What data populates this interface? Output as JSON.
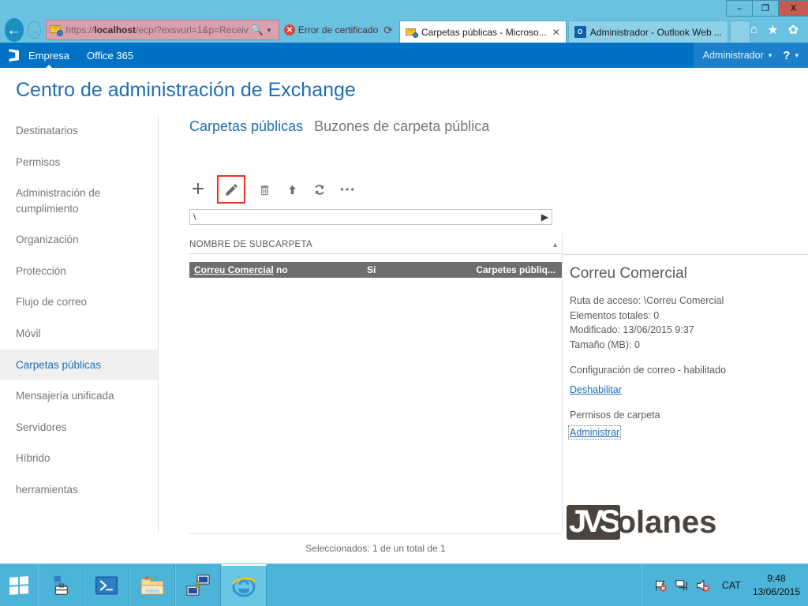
{
  "browser": {
    "window_buttons": {
      "minimize": "–",
      "maximize": "❐",
      "close": "X"
    },
    "back_label": "←",
    "forward_label": "→",
    "address": {
      "scheme": "https://",
      "host": "localhost",
      "path": "/ecp/?exsvurl=1&p=Receiv",
      "full": "https://localhost/ecp/?exsvurl=1&p=Receiv"
    },
    "search_icon": "search-icon",
    "certificate_error": "Error de certificado",
    "refresh_icon": "refresh-icon",
    "tabs": [
      {
        "title": "Carpetas públicas - Microso...",
        "icon": "exchange-envelope-icon",
        "active": true,
        "close": "✕"
      },
      {
        "title": "Administrador - Outlook Web ...",
        "icon": "outlook-icon",
        "active": false
      }
    ],
    "right_icons": [
      "home-icon",
      "favorites-star-icon",
      "settings-gear-icon"
    ]
  },
  "suite": {
    "logo": "office-waffle-icon",
    "links": [
      {
        "label": "Empresa",
        "selected": true
      },
      {
        "label": "Office 365",
        "selected": false
      }
    ],
    "user": "Administrador",
    "user_caret": "▾",
    "help": "?",
    "help_caret": "▾"
  },
  "page": {
    "title": "Centro de administración de Exchange"
  },
  "sidebar": {
    "items": [
      {
        "label": "Destinatarios",
        "active": false
      },
      {
        "label": "Permisos",
        "active": false
      },
      {
        "label": "Administración de cumplimiento",
        "active": false
      },
      {
        "label": "Organización",
        "active": false
      },
      {
        "label": "Protección",
        "active": false
      },
      {
        "label": "Flujo de correo",
        "active": false
      },
      {
        "label": "Móvil",
        "active": false
      },
      {
        "label": "Carpetas públicas",
        "active": true
      },
      {
        "label": "Mensajería unificada",
        "active": false
      },
      {
        "label": "Servidores",
        "active": false
      },
      {
        "label": "Híbrido",
        "active": false
      },
      {
        "label": "herramientas",
        "active": false
      }
    ]
  },
  "main": {
    "tabs": [
      {
        "label": "Carpetas públicas",
        "active": true
      },
      {
        "label": "Buzones de carpeta pública",
        "active": false
      }
    ],
    "toolbar": [
      {
        "name": "add-button",
        "icon": "plus-icon",
        "highlighted": false
      },
      {
        "name": "edit-button",
        "icon": "pencil-icon",
        "highlighted": true
      },
      {
        "name": "delete-button",
        "icon": "trash-icon",
        "highlighted": false
      },
      {
        "name": "move-up-button",
        "icon": "arrow-up-icon",
        "highlighted": false
      },
      {
        "name": "refresh-button",
        "icon": "refresh-icon",
        "highlighted": false
      },
      {
        "name": "more-button",
        "icon": "ellipsis-icon",
        "highlighted": false
      }
    ],
    "path_input": {
      "value": "\\",
      "go_icon": "▶"
    },
    "columns": [
      "NOMBRE DE SUBCARPETA"
    ],
    "sort_indicator": "▲",
    "rows": [
      {
        "name": "Correu Comercial",
        "col2": "no",
        "col3": "Sí",
        "col4": "Carpetes públiq...",
        "selected": true
      }
    ],
    "status": "Seleccionados: 1 de un total de 1"
  },
  "detail": {
    "title": "Correu Comercial",
    "lines": [
      "Ruta de acceso: \\Correu Comercial",
      "Elementos totales: 0",
      "Modificado: 13/06/2015 9:37",
      "Tamaño (MB): 0"
    ],
    "mail_section_label": "Configuración de correo - habilitado",
    "mail_section_link": "Deshabilitar",
    "perm_section_label": "Permisos de carpeta",
    "perm_section_link": "Administrar"
  },
  "watermark": {
    "boxed": "JVS",
    "rest": "olanes"
  },
  "taskbar": {
    "start_icon": "windows-start-icon",
    "apps": [
      {
        "name": "server-manager-icon",
        "active": false
      },
      {
        "name": "powershell-icon",
        "active": false
      },
      {
        "name": "file-explorer-icon",
        "active": false
      },
      {
        "name": "remote-desktop-icon",
        "active": false
      },
      {
        "name": "internet-explorer-icon",
        "active": true
      }
    ],
    "tray_icons": [
      "action-center-flag-icon",
      "network-icon",
      "volume-muted-icon"
    ],
    "language": "CAT",
    "time": "9:48",
    "date": "13/06/2015"
  },
  "colors": {
    "accent_blue": "#1f6fb5",
    "suite_blue": "#0072c6",
    "ie_chrome": "#6ac1e0",
    "highlight_red": "#ee3124",
    "row_selected": "#6e6e6e",
    "taskbar": "#4cb3d9"
  }
}
